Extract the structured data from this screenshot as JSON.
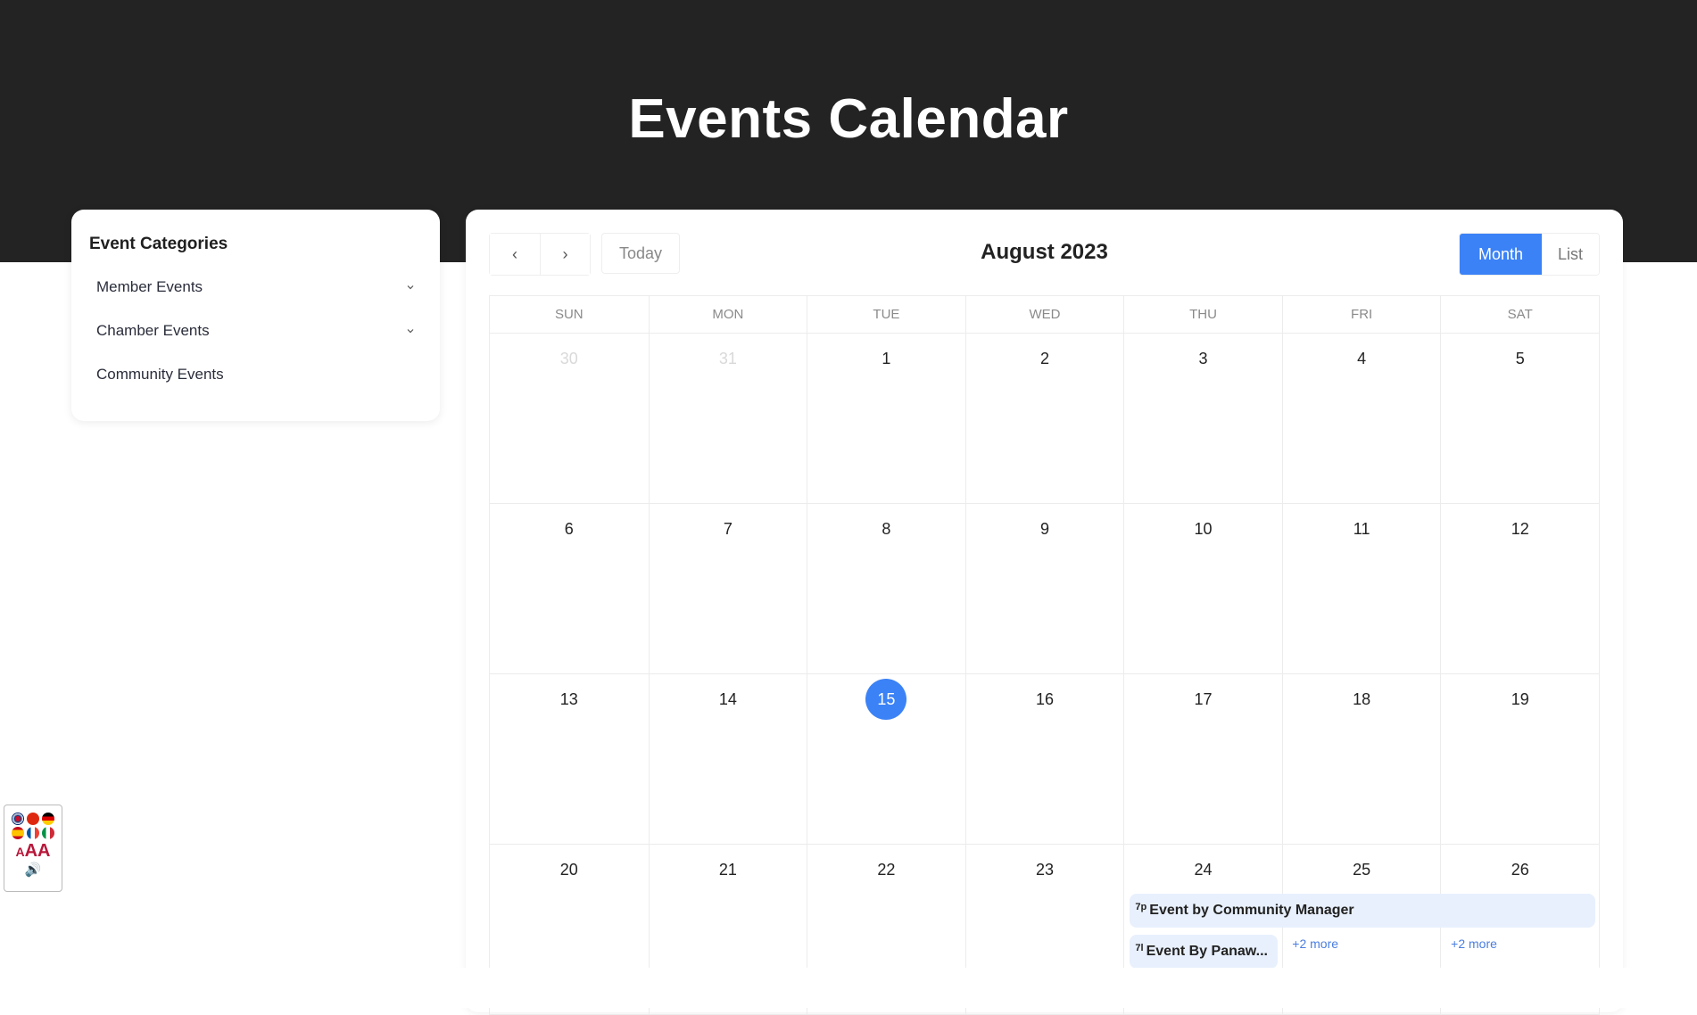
{
  "header": {
    "title": "Events Calendar"
  },
  "sidebar": {
    "title": "Event Categories",
    "items": [
      {
        "label": "Member Events",
        "expandable": true
      },
      {
        "label": "Chamber Events",
        "expandable": true
      },
      {
        "label": "Community Events",
        "expandable": false
      }
    ]
  },
  "toolbar": {
    "prev_icon": "‹",
    "next_icon": "›",
    "today_label": "Today",
    "month_title": "August 2023",
    "views": [
      {
        "label": "Month",
        "active": true
      },
      {
        "label": "List",
        "active": false
      }
    ]
  },
  "calendar": {
    "weekdays": [
      "SUN",
      "MON",
      "TUE",
      "WED",
      "THU",
      "FRI",
      "SAT"
    ],
    "today": "15",
    "weeks": [
      [
        "30",
        "31",
        "1",
        "2",
        "3",
        "4",
        "5"
      ],
      [
        "6",
        "7",
        "8",
        "9",
        "10",
        "11",
        "12"
      ],
      [
        "13",
        "14",
        "15",
        "16",
        "17",
        "18",
        "19"
      ],
      [
        "20",
        "21",
        "22",
        "23",
        "24",
        "25",
        "26"
      ]
    ],
    "other_month": [
      "30",
      "31"
    ],
    "events": [
      {
        "time": "7p",
        "title": "Event by Community Manager",
        "start": "24",
        "end": "26"
      },
      {
        "time": "7l",
        "title": "Event By Panaw...",
        "start": "24",
        "end": "24"
      }
    ],
    "more_links": [
      {
        "day": "25",
        "label": "+2 more"
      },
      {
        "day": "26",
        "label": "+2 more"
      }
    ]
  },
  "accessibility_widget": {
    "flags": [
      "uk",
      "cn",
      "de",
      "es",
      "fr",
      "it"
    ],
    "text_size_label": "AAA",
    "text_size_label_small": "A",
    "speaker_icon": "🔊"
  }
}
